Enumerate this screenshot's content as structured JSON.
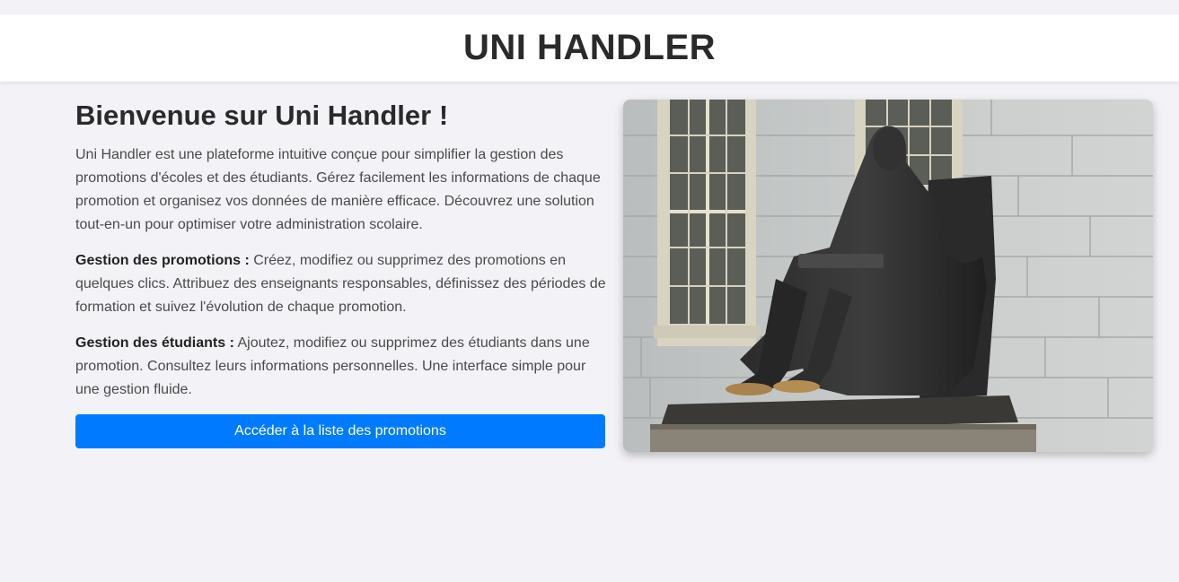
{
  "header": {
    "title": "UNI HANDLER"
  },
  "main": {
    "heading": "Bienvenue sur Uni Handler !",
    "intro": "Uni Handler est une plateforme intuitive conçue pour simplifier la gestion des promotions d'écoles et des étudiants. Gérez facilement les informations de chaque promotion et organisez vos données de manière efficace. Découvrez une solution tout-en-un pour optimiser votre administration scolaire.",
    "feature_promotions": {
      "label": "Gestion des promotions :",
      "text": " Créez, modifiez ou supprimez des promotions en quelques clics. Attribuez des enseignants responsables, définissez des périodes de formation et suivez l'évolution de chaque promotion."
    },
    "feature_students": {
      "label": "Gestion des étudiants :",
      "text": " Ajoutez, modifiez ou supprimez des étudiants dans une promotion. Consultez leurs informations personnelles. Une interface simple pour une gestion fluide."
    },
    "cta_label": "Accéder à la liste des promotions"
  },
  "image": {
    "subject": "statue-photo"
  },
  "colors": {
    "accent": "#007bff",
    "background": "#f3f3f7",
    "header_bg": "#ffffff",
    "heading": "#2a2a2a"
  }
}
